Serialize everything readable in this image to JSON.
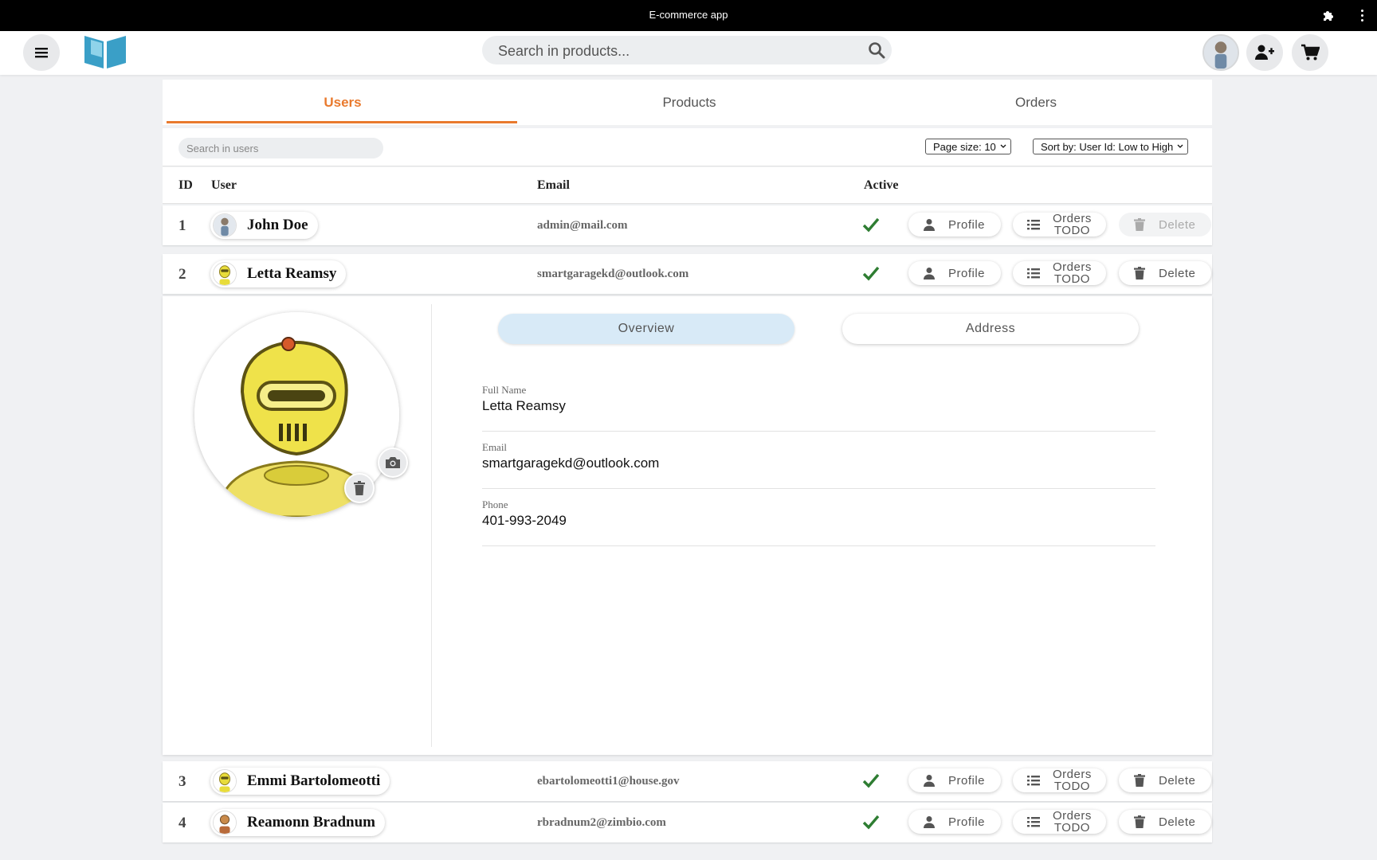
{
  "window": {
    "title": "E-commerce app"
  },
  "header": {
    "search_placeholder": "Search in products...",
    "icons": [
      "menu-icon",
      "logo-book",
      "search-icon",
      "user-avatar",
      "add-user-icon",
      "cart-icon",
      "extension-icon",
      "more-vert-icon"
    ]
  },
  "tabs": [
    {
      "label": "Users",
      "active": true
    },
    {
      "label": "Products",
      "active": false
    },
    {
      "label": "Orders",
      "active": false
    }
  ],
  "toolbar": {
    "search_placeholder": "Search in users",
    "page_size": "Page size: 10",
    "sort_by": "Sort by: User Id: Low to High"
  },
  "table": {
    "columns": [
      "ID",
      "User",
      "Email",
      "Active"
    ],
    "actions": {
      "profile": "Profile",
      "orders_line1": "Orders",
      "orders_line2": "TODO",
      "delete": "Delete"
    },
    "rows": [
      {
        "id": "1",
        "name": "John Doe",
        "email": "admin@mail.com",
        "active": true
      },
      {
        "id": "2",
        "name": "Letta Reamsy",
        "email": "smartgaragekd@outlook.com",
        "active": true
      },
      {
        "id": "3",
        "name": "Emmi Bartolomeotti",
        "email": "ebartolomeotti1@house.gov",
        "active": true
      },
      {
        "id": "4",
        "name": "Reamonn Bradnum",
        "email": "rbradnum2@zimbio.com",
        "active": true
      }
    ]
  },
  "detail": {
    "segments": [
      "Overview",
      "Address"
    ],
    "fields": [
      {
        "label": "Full Name",
        "value": "Letta Reamsy"
      },
      {
        "label": "Email",
        "value": "smartgaragekd@outlook.com"
      },
      {
        "label": "Phone",
        "value": "401-993-2049"
      }
    ]
  },
  "colors": {
    "accent": "#e97a2e",
    "check": "#2e7d32",
    "segment_active": "#d8eaf7",
    "logo": "#3a9fc7"
  }
}
